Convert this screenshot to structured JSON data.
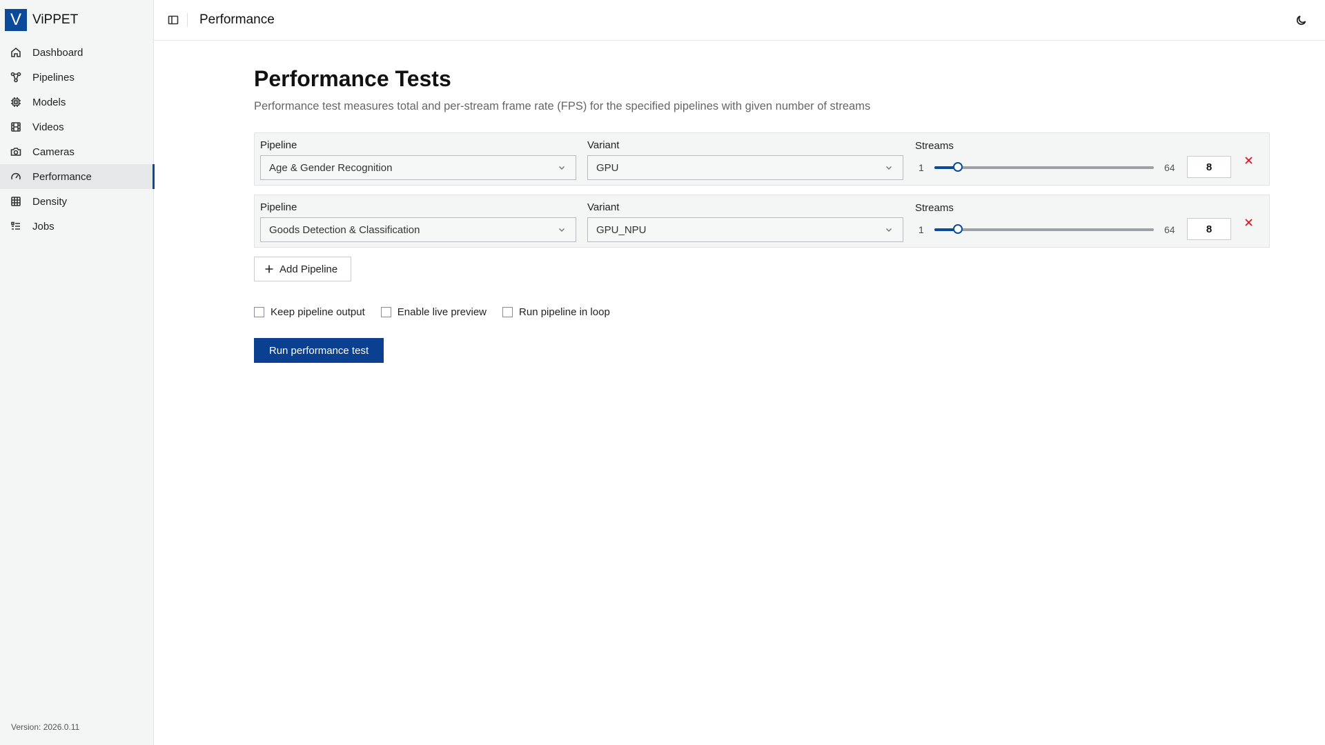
{
  "app": {
    "logo_letter": "V",
    "name": "ViPPET",
    "version": "Version: 2026.0.11"
  },
  "sidebar": {
    "items": [
      {
        "label": "Dashboard",
        "icon": "home-icon"
      },
      {
        "label": "Pipelines",
        "icon": "pipeline-icon"
      },
      {
        "label": "Models",
        "icon": "chip-icon"
      },
      {
        "label": "Videos",
        "icon": "film-icon"
      },
      {
        "label": "Cameras",
        "icon": "camera-icon"
      },
      {
        "label": "Performance",
        "icon": "gauge-icon",
        "active": true
      },
      {
        "label": "Density",
        "icon": "grid-icon"
      },
      {
        "label": "Jobs",
        "icon": "list-icon"
      }
    ]
  },
  "header": {
    "title": "Performance",
    "toggle_icon": "sidebar-toggle-icon",
    "theme_icon": "moon-icon"
  },
  "main": {
    "title": "Performance Tests",
    "description": "Performance test measures total and per-stream frame rate (FPS) for the specified pipelines with given number of streams",
    "pipeline_label": "Pipeline",
    "variant_label": "Variant",
    "streams_label": "Streams",
    "rows": [
      {
        "pipeline": "Age & Gender Recognition",
        "variant": "GPU",
        "streams_min": "1",
        "streams_max": "64",
        "streams": "8"
      },
      {
        "pipeline": "Goods Detection & Classification",
        "variant": "GPU_NPU",
        "streams_min": "1",
        "streams_max": "64",
        "streams": "8"
      }
    ],
    "add_pipeline_label": "Add Pipeline",
    "options": [
      {
        "label": "Keep pipeline output",
        "checked": false
      },
      {
        "label": "Enable live preview",
        "checked": false
      },
      {
        "label": "Run pipeline in loop",
        "checked": false
      }
    ],
    "run_button_label": "Run performance test"
  },
  "colors": {
    "accent": "#0b4a9a",
    "button": "#0b3f8f",
    "danger": "#d0182c",
    "sidebar_bg": "#f4f5f5"
  }
}
